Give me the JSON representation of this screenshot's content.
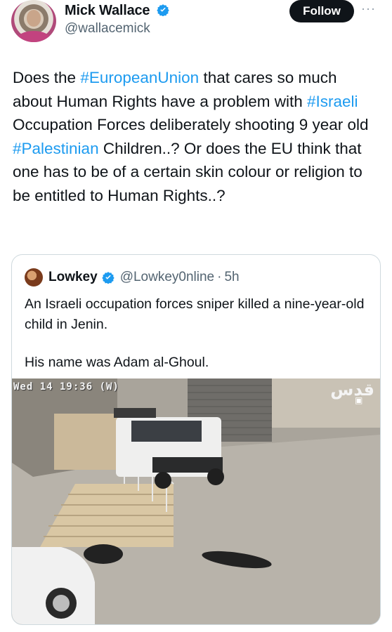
{
  "post": {
    "author_name": "Mick Wallace",
    "author_handle": "@wallacemick",
    "follow_label": "Follow",
    "more_label": "···",
    "text_parts": [
      {
        "t": "Does the ",
        "tag": false
      },
      {
        "t": "#EuropeanUnion",
        "tag": true
      },
      {
        "t": " that cares so much about Human Rights have a problem with ",
        "tag": false
      },
      {
        "t": "#Israeli",
        "tag": true
      },
      {
        "t": " Occupation Forces deliberately shooting 9 year old ",
        "tag": false
      },
      {
        "t": "#Palestinian",
        "tag": true
      },
      {
        "t": " Children..? Or does the EU think that one has to be of a certain skin colour or religion to be entitled to Human Rights..?",
        "tag": false
      }
    ]
  },
  "quote": {
    "author_name": "Lowkey",
    "author_handle": "@Lowkey0nline",
    "dot": "·",
    "time": "5h",
    "line1": "An Israeli occupation forces sniper killed a nine-year-old child in Jenin.",
    "line2": "His name was Adam al-Ghoul.",
    "video": {
      "timestamp": "Wed 14 19:36 (W)",
      "logo_text": "قدس"
    }
  },
  "colors": {
    "link": "#1d9bf0",
    "verified": "#1d9bf0",
    "text": "#0f1419",
    "muted": "#536471"
  }
}
